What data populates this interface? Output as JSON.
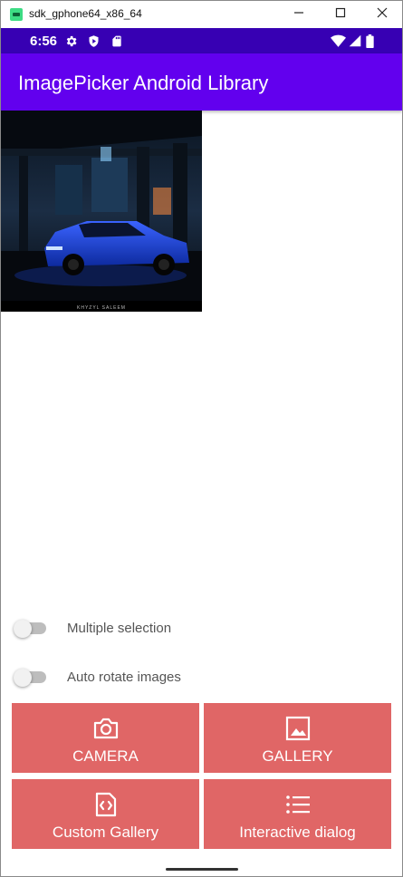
{
  "window": {
    "title": "sdk_gphone64_x86_64",
    "minimize_icon": "minimize-icon",
    "maximize_icon": "maximize-icon",
    "close_icon": "close-icon"
  },
  "status_bar": {
    "time": "6:56",
    "icons": [
      "gear-icon",
      "shield-icon",
      "sd-card-icon",
      "wifi-icon",
      "signal-icon",
      "battery-icon"
    ]
  },
  "app_bar": {
    "title": "ImagePicker Android Library",
    "color": "#6200ee"
  },
  "image": {
    "description_icon": "picked-image",
    "watermark": "KHYZYL SALEEM"
  },
  "switches": [
    {
      "label": "Multiple selection",
      "checked": false
    },
    {
      "label": "Auto rotate images",
      "checked": false
    }
  ],
  "buttons": {
    "camera": {
      "label": "CAMERA",
      "icon": "camera-icon"
    },
    "gallery": {
      "label": "GALLERY",
      "icon": "image-icon"
    },
    "custom_gallery": {
      "label": "Custom Gallery",
      "icon": "code-file-icon"
    },
    "interactive_dialog": {
      "label": "Interactive dialog",
      "icon": "list-icon"
    },
    "color": "#e06666"
  }
}
